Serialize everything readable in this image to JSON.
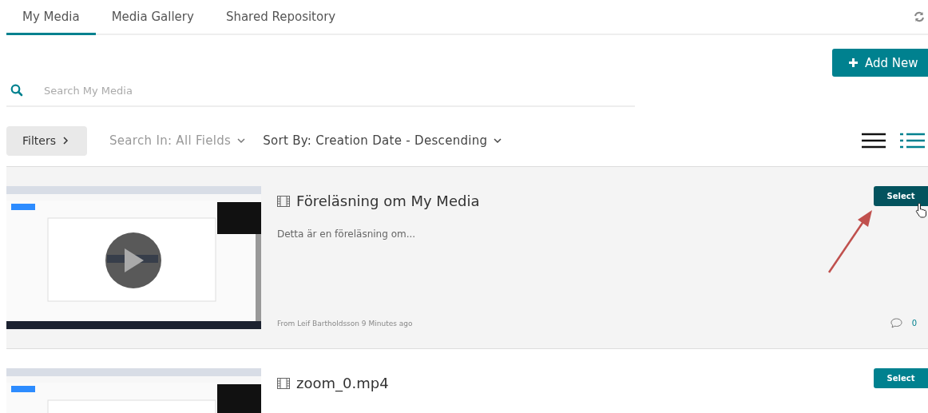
{
  "tabs": [
    {
      "label": "My Media",
      "selected": true
    },
    {
      "label": "Media Gallery",
      "selected": false
    },
    {
      "label": "Shared Repository",
      "selected": false
    }
  ],
  "add_button": {
    "label": "Add New"
  },
  "search": {
    "placeholder": "Search My Media"
  },
  "toolbar": {
    "filters": "Filters",
    "search_in": "Search In: All Fields",
    "sort_by": "Sort By: Creation Date - Descending"
  },
  "view_modes": [
    {
      "kind": "compact",
      "selected": false
    },
    {
      "kind": "detailed",
      "selected": true
    }
  ],
  "media": [
    {
      "title": "Föreläsning om My Media",
      "description": "Detta är en föreläsning om...",
      "meta": "From Leif Bartholdsson 9 Minutes ago",
      "comments": "0",
      "button": "Select",
      "hovered": true
    },
    {
      "title": "zoom_0.mp4",
      "button": "Select",
      "hovered": false
    }
  ]
}
